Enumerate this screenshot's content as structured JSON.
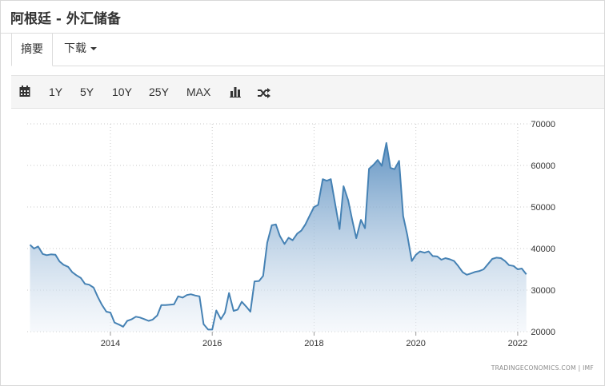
{
  "header": {
    "title": "阿根廷 - 外汇储备"
  },
  "tabs": {
    "summary": "摘要",
    "download": "下载"
  },
  "toolbar": {
    "ranges": [
      "1Y",
      "5Y",
      "10Y",
      "25Y",
      "MAX"
    ]
  },
  "icons": {
    "calendar": "calendar-icon",
    "bar_chart": "bar-chart-icon",
    "shuffle": "shuffle-icon",
    "caret": "caret-down-icon"
  },
  "colors": {
    "line": "#4682b4",
    "fill_top": "#5b8fc0",
    "fill_bottom": "#eef3f9",
    "grid": "#c8c8c8"
  },
  "chart_data": {
    "type": "area",
    "source_label": "TRADINGECONOMICS.COM  |  IMF",
    "xlim": [
      2012.35,
      2022.3
    ],
    "ylim": [
      20000,
      70000
    ],
    "x_ticks": [
      2014,
      2016,
      2018,
      2020,
      2022
    ],
    "y_ticks": [
      20000,
      30000,
      40000,
      50000,
      60000,
      70000
    ],
    "grid": "dotted",
    "series": [
      {
        "x": [
          2012.42,
          2012.5,
          2012.58,
          2012.67,
          2012.75,
          2012.83,
          2012.92,
          2013.0,
          2013.08,
          2013.17,
          2013.25,
          2013.33,
          2013.42,
          2013.5,
          2013.58,
          2013.67,
          2013.75,
          2013.83,
          2013.92,
          2014.0,
          2014.08,
          2014.17,
          2014.25,
          2014.33,
          2014.42,
          2014.5,
          2014.58,
          2014.67,
          2014.75,
          2014.83,
          2014.92,
          2015.0,
          2015.08,
          2015.17,
          2015.25,
          2015.33,
          2015.42,
          2015.5,
          2015.58,
          2015.67,
          2015.75,
          2015.83,
          2015.92,
          2016.0,
          2016.08,
          2016.17,
          2016.25,
          2016.33,
          2016.42,
          2016.5,
          2016.58,
          2016.67,
          2016.75,
          2016.83,
          2016.92,
          2017.0,
          2017.08,
          2017.17,
          2017.25,
          2017.33,
          2017.42,
          2017.5,
          2017.58,
          2017.67,
          2017.75,
          2017.83,
          2017.92,
          2018.0,
          2018.08,
          2018.17,
          2018.25,
          2018.33,
          2018.42,
          2018.5,
          2018.58,
          2018.67,
          2018.75,
          2018.83,
          2018.92,
          2019.0,
          2019.08,
          2019.17,
          2019.25,
          2019.33,
          2019.42,
          2019.5,
          2019.58,
          2019.67,
          2019.75,
          2019.83,
          2019.92,
          2020.0,
          2020.08,
          2020.17,
          2020.25,
          2020.33,
          2020.42,
          2020.5,
          2020.58,
          2020.67,
          2020.75,
          2020.83,
          2020.92,
          2021.0,
          2021.08,
          2021.17,
          2021.25,
          2021.33,
          2021.42,
          2021.5,
          2021.58,
          2021.67,
          2021.75,
          2021.83,
          2021.92,
          2022.0,
          2022.08,
          2022.17
        ],
        "y": [
          40900,
          40000,
          40500,
          38700,
          38400,
          38600,
          38500,
          36900,
          36100,
          35600,
          34300,
          33600,
          32900,
          31500,
          31300,
          30600,
          28400,
          26500,
          24800,
          24600,
          22200,
          21700,
          21200,
          22600,
          23000,
          23600,
          23400,
          23000,
          22600,
          22900,
          23900,
          26400,
          26400,
          26500,
          26600,
          28500,
          28200,
          28800,
          29000,
          28700,
          28500,
          21800,
          20500,
          20500,
          25100,
          23000,
          24600,
          29300,
          25000,
          25300,
          27200,
          26000,
          24800,
          32100,
          32200,
          33400,
          41400,
          45600,
          45800,
          43000,
          41100,
          42600,
          42000,
          43600,
          44300,
          45800,
          48100,
          50000,
          50500,
          56700,
          56300,
          56700,
          50300,
          44700,
          55000,
          51600,
          46800,
          42500,
          46900,
          44900,
          59200,
          60200,
          61300,
          59900,
          65400,
          59400,
          59100,
          61100,
          47800,
          43300,
          37000,
          38500,
          39300,
          39000,
          39300,
          38200,
          38100,
          37300,
          37700,
          37400,
          37000,
          35800,
          34300,
          33700,
          34000,
          34400,
          34600,
          35000,
          36300,
          37500,
          37800,
          37700,
          37000,
          36000,
          35800,
          35000,
          35200,
          33800
        ]
      }
    ]
  }
}
